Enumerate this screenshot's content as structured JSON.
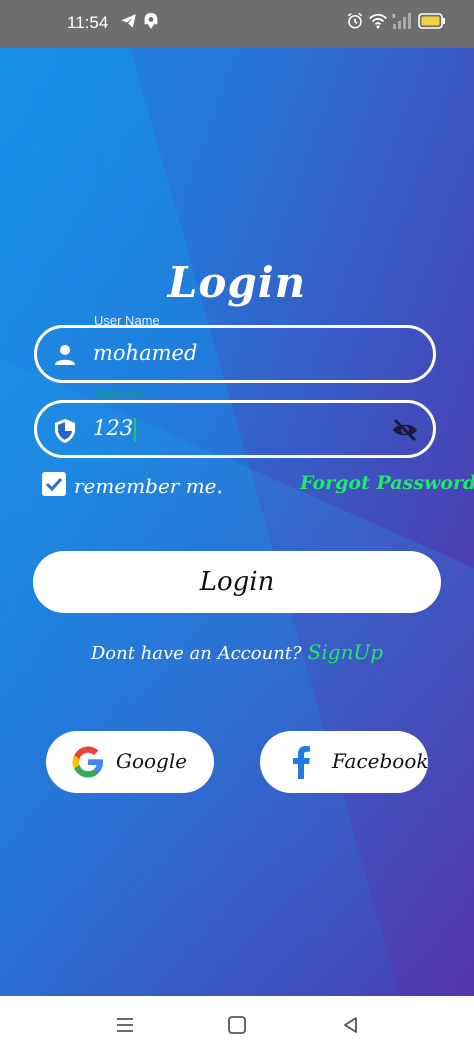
{
  "status_bar": {
    "time": "11:54",
    "icons": [
      "telegram-icon",
      "notification-app-icon",
      "alarm-icon",
      "wifi-icon",
      "signal-icon",
      "battery-icon"
    ]
  },
  "login": {
    "title": "Login",
    "username": {
      "label": "User Name",
      "value": "mohamed"
    },
    "password": {
      "label": "Password",
      "value": "123"
    },
    "remember_label": "remember me.",
    "remember_checked": true,
    "forgot_label": "Forgot Password?",
    "login_button": "Login",
    "no_account_text": "Dont have an Account?",
    "signup_link": "SignUp"
  },
  "social": {
    "google_label": "Google",
    "facebook_label": "Facebook"
  },
  "colors": {
    "accent_green": "#1fe86b",
    "gradient_start": "#1f8ce3",
    "gradient_end": "#5b2aa5"
  },
  "nav_bar": {
    "buttons": [
      "menu-icon",
      "home-icon",
      "back-icon"
    ]
  }
}
